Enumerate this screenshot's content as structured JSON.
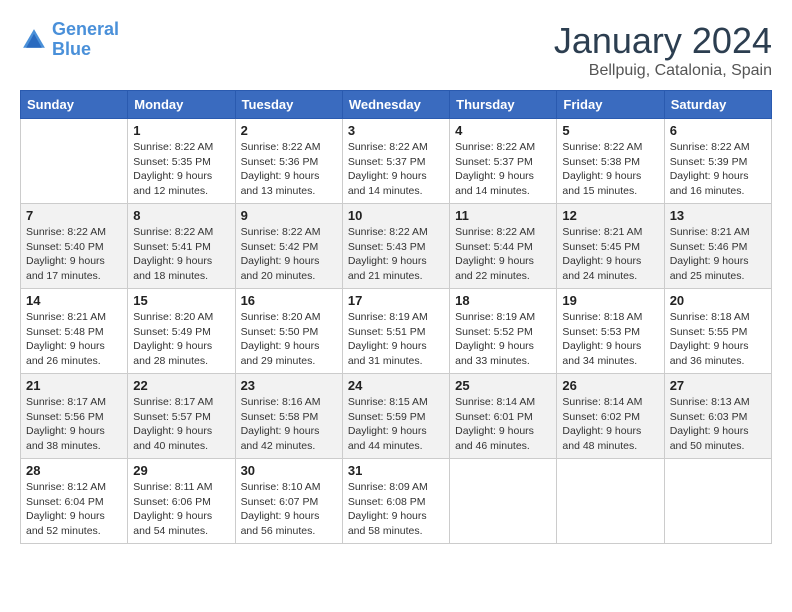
{
  "logo": {
    "text_general": "General",
    "text_blue": "Blue"
  },
  "title": "January 2024",
  "location": "Bellpuig, Catalonia, Spain",
  "days_header": [
    "Sunday",
    "Monday",
    "Tuesday",
    "Wednesday",
    "Thursday",
    "Friday",
    "Saturday"
  ],
  "weeks": [
    [
      {
        "num": "",
        "sunrise": "",
        "sunset": "",
        "daylight": ""
      },
      {
        "num": "1",
        "sunrise": "Sunrise: 8:22 AM",
        "sunset": "Sunset: 5:35 PM",
        "daylight": "Daylight: 9 hours and 12 minutes."
      },
      {
        "num": "2",
        "sunrise": "Sunrise: 8:22 AM",
        "sunset": "Sunset: 5:36 PM",
        "daylight": "Daylight: 9 hours and 13 minutes."
      },
      {
        "num": "3",
        "sunrise": "Sunrise: 8:22 AM",
        "sunset": "Sunset: 5:37 PM",
        "daylight": "Daylight: 9 hours and 14 minutes."
      },
      {
        "num": "4",
        "sunrise": "Sunrise: 8:22 AM",
        "sunset": "Sunset: 5:37 PM",
        "daylight": "Daylight: 9 hours and 14 minutes."
      },
      {
        "num": "5",
        "sunrise": "Sunrise: 8:22 AM",
        "sunset": "Sunset: 5:38 PM",
        "daylight": "Daylight: 9 hours and 15 minutes."
      },
      {
        "num": "6",
        "sunrise": "Sunrise: 8:22 AM",
        "sunset": "Sunset: 5:39 PM",
        "daylight": "Daylight: 9 hours and 16 minutes."
      }
    ],
    [
      {
        "num": "7",
        "sunrise": "Sunrise: 8:22 AM",
        "sunset": "Sunset: 5:40 PM",
        "daylight": "Daylight: 9 hours and 17 minutes."
      },
      {
        "num": "8",
        "sunrise": "Sunrise: 8:22 AM",
        "sunset": "Sunset: 5:41 PM",
        "daylight": "Daylight: 9 hours and 18 minutes."
      },
      {
        "num": "9",
        "sunrise": "Sunrise: 8:22 AM",
        "sunset": "Sunset: 5:42 PM",
        "daylight": "Daylight: 9 hours and 20 minutes."
      },
      {
        "num": "10",
        "sunrise": "Sunrise: 8:22 AM",
        "sunset": "Sunset: 5:43 PM",
        "daylight": "Daylight: 9 hours and 21 minutes."
      },
      {
        "num": "11",
        "sunrise": "Sunrise: 8:22 AM",
        "sunset": "Sunset: 5:44 PM",
        "daylight": "Daylight: 9 hours and 22 minutes."
      },
      {
        "num": "12",
        "sunrise": "Sunrise: 8:21 AM",
        "sunset": "Sunset: 5:45 PM",
        "daylight": "Daylight: 9 hours and 24 minutes."
      },
      {
        "num": "13",
        "sunrise": "Sunrise: 8:21 AM",
        "sunset": "Sunset: 5:46 PM",
        "daylight": "Daylight: 9 hours and 25 minutes."
      }
    ],
    [
      {
        "num": "14",
        "sunrise": "Sunrise: 8:21 AM",
        "sunset": "Sunset: 5:48 PM",
        "daylight": "Daylight: 9 hours and 26 minutes."
      },
      {
        "num": "15",
        "sunrise": "Sunrise: 8:20 AM",
        "sunset": "Sunset: 5:49 PM",
        "daylight": "Daylight: 9 hours and 28 minutes."
      },
      {
        "num": "16",
        "sunrise": "Sunrise: 8:20 AM",
        "sunset": "Sunset: 5:50 PM",
        "daylight": "Daylight: 9 hours and 29 minutes."
      },
      {
        "num": "17",
        "sunrise": "Sunrise: 8:19 AM",
        "sunset": "Sunset: 5:51 PM",
        "daylight": "Daylight: 9 hours and 31 minutes."
      },
      {
        "num": "18",
        "sunrise": "Sunrise: 8:19 AM",
        "sunset": "Sunset: 5:52 PM",
        "daylight": "Daylight: 9 hours and 33 minutes."
      },
      {
        "num": "19",
        "sunrise": "Sunrise: 8:18 AM",
        "sunset": "Sunset: 5:53 PM",
        "daylight": "Daylight: 9 hours and 34 minutes."
      },
      {
        "num": "20",
        "sunrise": "Sunrise: 8:18 AM",
        "sunset": "Sunset: 5:55 PM",
        "daylight": "Daylight: 9 hours and 36 minutes."
      }
    ],
    [
      {
        "num": "21",
        "sunrise": "Sunrise: 8:17 AM",
        "sunset": "Sunset: 5:56 PM",
        "daylight": "Daylight: 9 hours and 38 minutes."
      },
      {
        "num": "22",
        "sunrise": "Sunrise: 8:17 AM",
        "sunset": "Sunset: 5:57 PM",
        "daylight": "Daylight: 9 hours and 40 minutes."
      },
      {
        "num": "23",
        "sunrise": "Sunrise: 8:16 AM",
        "sunset": "Sunset: 5:58 PM",
        "daylight": "Daylight: 9 hours and 42 minutes."
      },
      {
        "num": "24",
        "sunrise": "Sunrise: 8:15 AM",
        "sunset": "Sunset: 5:59 PM",
        "daylight": "Daylight: 9 hours and 44 minutes."
      },
      {
        "num": "25",
        "sunrise": "Sunrise: 8:14 AM",
        "sunset": "Sunset: 6:01 PM",
        "daylight": "Daylight: 9 hours and 46 minutes."
      },
      {
        "num": "26",
        "sunrise": "Sunrise: 8:14 AM",
        "sunset": "Sunset: 6:02 PM",
        "daylight": "Daylight: 9 hours and 48 minutes."
      },
      {
        "num": "27",
        "sunrise": "Sunrise: 8:13 AM",
        "sunset": "Sunset: 6:03 PM",
        "daylight": "Daylight: 9 hours and 50 minutes."
      }
    ],
    [
      {
        "num": "28",
        "sunrise": "Sunrise: 8:12 AM",
        "sunset": "Sunset: 6:04 PM",
        "daylight": "Daylight: 9 hours and 52 minutes."
      },
      {
        "num": "29",
        "sunrise": "Sunrise: 8:11 AM",
        "sunset": "Sunset: 6:06 PM",
        "daylight": "Daylight: 9 hours and 54 minutes."
      },
      {
        "num": "30",
        "sunrise": "Sunrise: 8:10 AM",
        "sunset": "Sunset: 6:07 PM",
        "daylight": "Daylight: 9 hours and 56 minutes."
      },
      {
        "num": "31",
        "sunrise": "Sunrise: 8:09 AM",
        "sunset": "Sunset: 6:08 PM",
        "daylight": "Daylight: 9 hours and 58 minutes."
      },
      {
        "num": "",
        "sunrise": "",
        "sunset": "",
        "daylight": ""
      },
      {
        "num": "",
        "sunrise": "",
        "sunset": "",
        "daylight": ""
      },
      {
        "num": "",
        "sunrise": "",
        "sunset": "",
        "daylight": ""
      }
    ]
  ]
}
